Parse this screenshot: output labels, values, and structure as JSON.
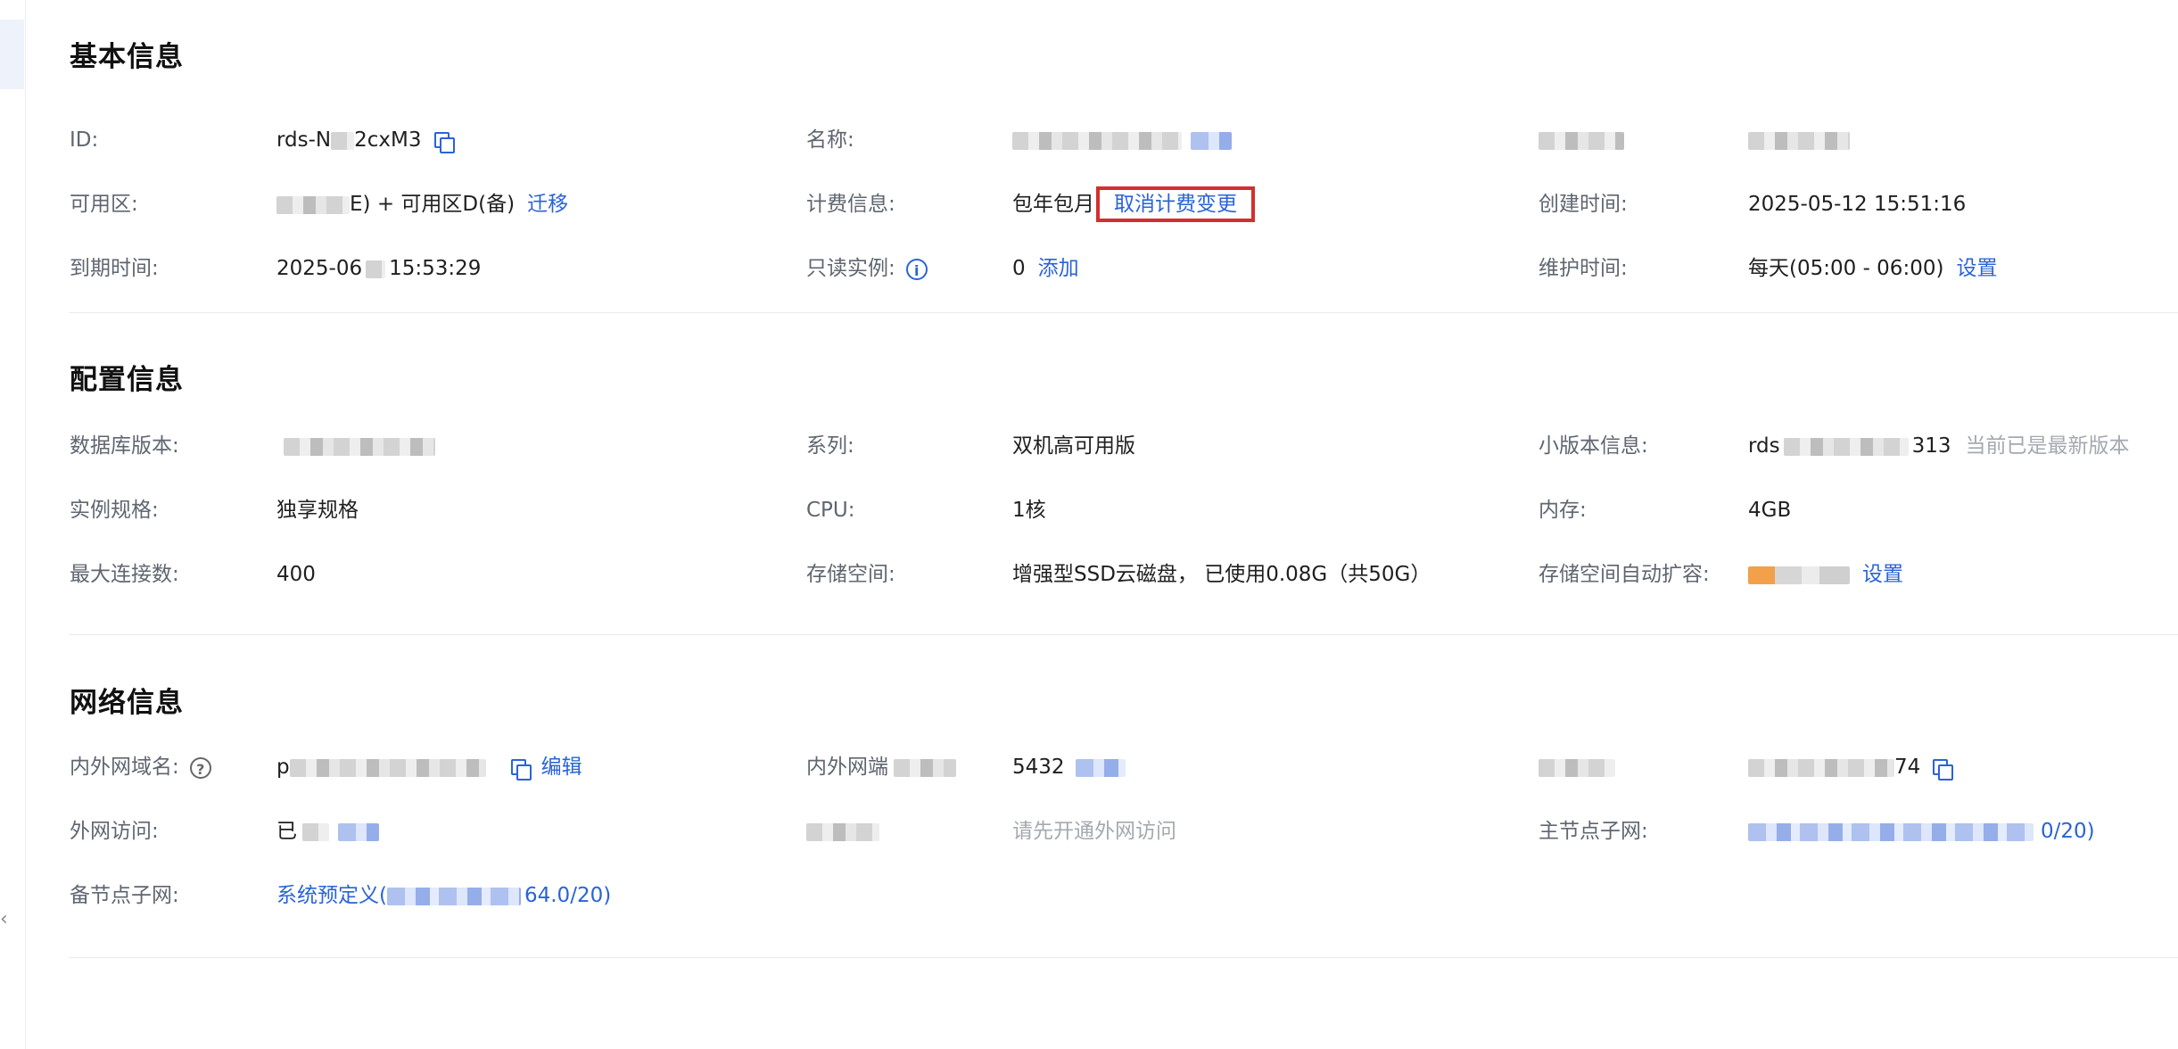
{
  "basic": {
    "title": "基本信息",
    "id_label": "ID:",
    "id_value": "rds-N",
    "id_value_tail": "2cxM3",
    "name_label": "名称:",
    "zone_label": "可用区:",
    "zone_value_tail": "E) + 可用区D(备)",
    "zone_link": "迁移",
    "billing_label": "计费信息:",
    "billing_value": "包年包月",
    "billing_link": "取消计费变更",
    "created_label": "创建时间:",
    "created_value": "2025-05-12 15:51:16",
    "expire_label": "到期时间:",
    "expire_value_head": "2025-06",
    "expire_value_tail": "15:53:29",
    "readonly_label": "只读实例:",
    "readonly_value": "0",
    "readonly_link": "添加",
    "maintain_label": "维护时间:",
    "maintain_value": "每天(05:00 - 06:00)",
    "maintain_link": "设置"
  },
  "config": {
    "title": "配置信息",
    "db_version_label": "数据库版本:",
    "series_label": "系列:",
    "series_value": "双机高可用版",
    "minor_label": "小版本信息:",
    "minor_value_head": "rds",
    "minor_value_tail": "313",
    "minor_note": "当前已是最新版本",
    "spec_label": "实例规格:",
    "spec_value": "独享规格",
    "cpu_label": "CPU:",
    "cpu_value": "1核",
    "memory_label": "内存:",
    "memory_value": "4GB",
    "maxconn_label": "最大连接数:",
    "maxconn_value": "400",
    "storage_label": "存储空间:",
    "storage_value": "增强型SSD云磁盘， 已使用0.08G（共50G）",
    "autoexpand_label": "存储空间自动扩容:",
    "autoexpand_link": "设置"
  },
  "network": {
    "title": "网络信息",
    "domain_label": "内外网域名:",
    "domain_value_head": "p",
    "domain_link": "编辑",
    "port_label": "内外网端",
    "port_value": "5432",
    "ip_value_tail": "74",
    "public_label": "外网访问:",
    "public_value_head": "已",
    "public_hint": "请先开通外网访问",
    "master_subnet_label": "主节点子网:",
    "master_subnet_tail": "0/20)",
    "standby_subnet_label": "备节点子网:",
    "standby_subnet_value": "系统预定义(",
    "standby_subnet_tail": "64.0/20)"
  }
}
